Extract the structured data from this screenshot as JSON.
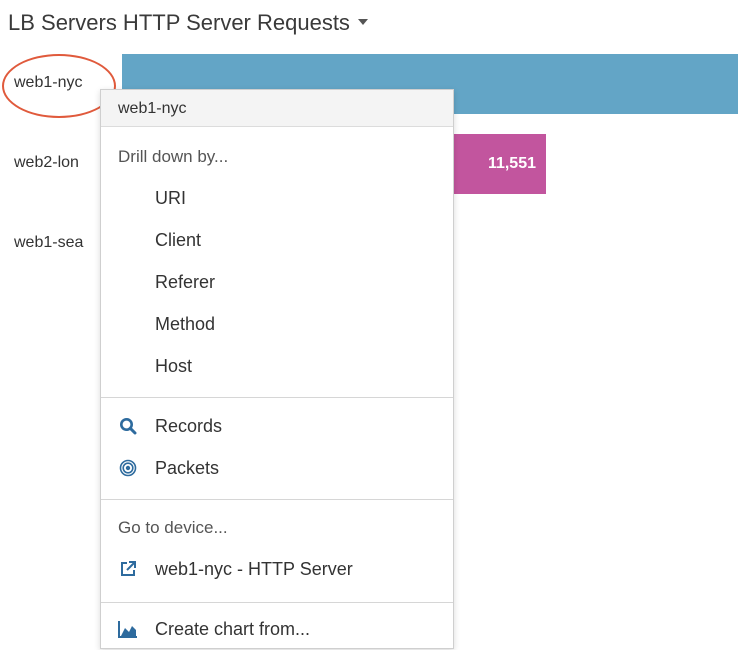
{
  "title": "LB Servers HTTP Server Requests",
  "rows": [
    {
      "label": "web1-nyc"
    },
    {
      "label": "web2-lon",
      "value": "11,551"
    },
    {
      "label": "web1-sea"
    }
  ],
  "colors": {
    "bar_nyc": "#63a5c6",
    "bar_lon": "#c2559e",
    "highlight": "#e05a3c",
    "icon": "#2e6b9e"
  },
  "menu": {
    "header": "web1-nyc",
    "drill_label": "Drill down by...",
    "drill_items": [
      "URI",
      "Client",
      "Referer",
      "Method",
      "Host"
    ],
    "records": "Records",
    "packets": "Packets",
    "goto_label": "Go to device...",
    "device_link": "web1-nyc - HTTP Server",
    "create_chart": "Create chart from..."
  },
  "icons": {
    "records": "search-icon",
    "packets": "packets-icon",
    "device": "external-link-icon",
    "chart": "area-chart-icon"
  }
}
